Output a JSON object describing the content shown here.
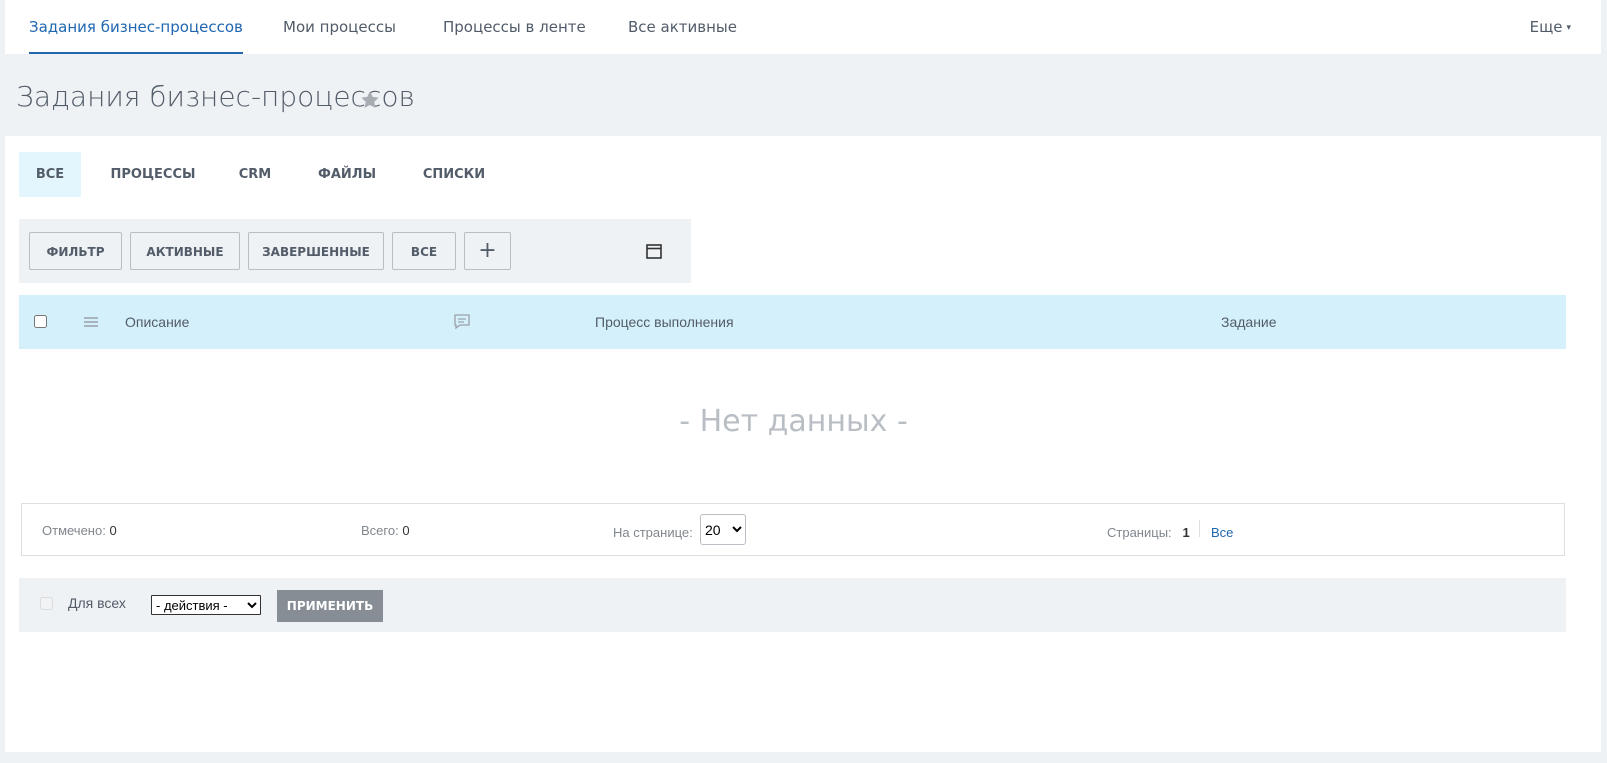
{
  "topnav": {
    "tabs": [
      {
        "label": "Задания бизнес-процессов"
      },
      {
        "label": "Мои процессы"
      },
      {
        "label": "Процессы в ленте"
      },
      {
        "label": "Все активные"
      }
    ],
    "more_label": "Еще"
  },
  "page": {
    "title": "Задания бизнес-процессов"
  },
  "subtabs": [
    {
      "label": "ВСЕ"
    },
    {
      "label": "ПРОЦЕССЫ"
    },
    {
      "label": "CRM"
    },
    {
      "label": "ФАЙЛЫ"
    },
    {
      "label": "СПИСКИ"
    }
  ],
  "filters": {
    "filter_label": "ФИЛЬТР",
    "active_label": "АКТИВНЫЕ",
    "completed_label": "ЗАВЕРШЕННЫЕ",
    "all_label": "ВСЕ",
    "add_label": "+"
  },
  "table": {
    "headers": {
      "description": "Описание",
      "progress": "Процесс выполнения",
      "task": "Задание"
    },
    "empty_text": "- Нет данных -"
  },
  "footer": {
    "checked_label": "Отмечено:",
    "checked_value": "0",
    "total_label": "Всего:",
    "total_value": "0",
    "per_page_label": "На странице:",
    "per_page_value": "20",
    "pages_label": "Страницы:",
    "current_page": "1",
    "all_pages_link": "Все"
  },
  "actions": {
    "for_all_label": "Для всех",
    "select_value": "- действия -",
    "apply_label": "ПРИМЕНИТЬ"
  },
  "colors": {
    "accent": "#2067b0",
    "header_bg": "#d4f0fa",
    "active_subtab_bg": "#e4f6fd",
    "apply_bg": "#868d95"
  }
}
